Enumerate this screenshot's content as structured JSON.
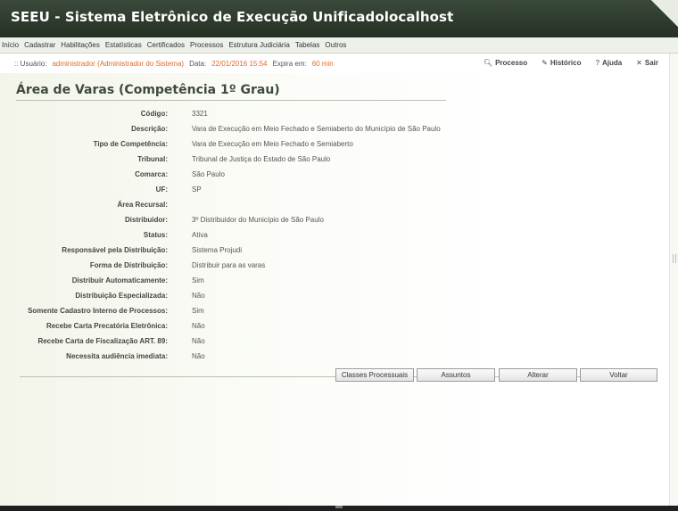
{
  "header": {
    "title": "SEEU - Sistema Eletrônico de Execução Unificadolocalhost"
  },
  "menu": {
    "items": [
      "Início",
      "Cadastrar",
      "Habilitações",
      "Estatísticas",
      "Certificados",
      "Processos",
      "Estrutura Judiciária",
      "Tabelas",
      "Outros"
    ]
  },
  "userbar": {
    "prefix": ":: Usuário:",
    "user": "administrador (Administrador do Sistema)",
    "date_label": "Data:",
    "date": "22/01/2016 15:54",
    "expires_label": "Expira em:",
    "expires": "60 min",
    "actions": [
      {
        "icon": "search-icon",
        "label": "Processo"
      },
      {
        "icon": "pencil-icon",
        "label": "Histórico"
      },
      {
        "icon": "help-icon",
        "label": "Ajuda"
      },
      {
        "icon": "close-icon",
        "label": "Sair"
      }
    ]
  },
  "page": {
    "title": "Área de Varas (Competência 1º Grau)"
  },
  "fields": [
    {
      "label": "Código:",
      "value": "3321"
    },
    {
      "label": "Descrição:",
      "value": "Vara de Execução em Meio Fechado e Semiaberto do Município de São Paulo"
    },
    {
      "label": "Tipo de Competência:",
      "value": "Vara de Execução em Meio Fechado e Semiaberto"
    },
    {
      "label": "Tribunal:",
      "value": "Tribunal de Justiça do Estado de São Paulo"
    },
    {
      "label": "Comarca:",
      "value": "São Paulo"
    },
    {
      "label": "UF:",
      "value": "SP"
    },
    {
      "label": "Área Recursal:",
      "value": ""
    },
    {
      "label": "Distribuidor:",
      "value": "3º Distribuidor do Município de São Paulo"
    },
    {
      "label": "Status:",
      "value": "Ativa"
    },
    {
      "label": "Responsável pela Distribuição:",
      "value": "Sistema Projudi"
    },
    {
      "label": "Forma de Distribuição:",
      "value": "Distribuir para as varas"
    },
    {
      "label": "Distribuir Automaticamente:",
      "value": "Sim"
    },
    {
      "label": "Distribuição Especializada:",
      "value": "Não"
    },
    {
      "label": "Somente Cadastro Interno de Processos:",
      "value": "Sim"
    },
    {
      "label": "Recebe Carta Precatória Eletrônica:",
      "value": "Não"
    },
    {
      "label": "Recebe Carta de Fiscalização ART. 89:",
      "value": "Não"
    },
    {
      "label": "Necessita audiência imediata:",
      "value": "Não"
    }
  ],
  "buttons": {
    "classes": "Classes Processuais",
    "assuntos": "Assuntos",
    "alterar": "Alterar",
    "voltar": "Voltar"
  }
}
